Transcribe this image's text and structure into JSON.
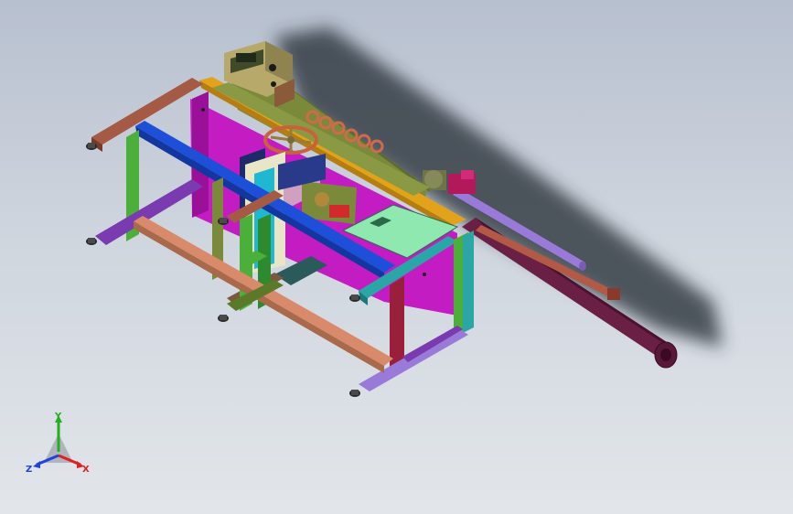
{
  "viewport": {
    "background_top": "#b7c0cf",
    "background_bottom": "#e2e6ea"
  },
  "model": {
    "description_icon": "cad-assembly-isometric",
    "colors": {
      "magenta_panel": "#c21cc2",
      "blue_beam": "#1d4fd8",
      "orange_beam": "#e2a21a",
      "green_leg": "#4caf3a",
      "olive_frame": "#7a8a3a",
      "brown_beam": "#a55a45",
      "salmon_beam": "#d98a6a",
      "purple_beam": "#7a3ab0",
      "maroon_leg": "#9a1f3a",
      "teal_beam": "#2aa6a6",
      "mint_plate": "#8fe8b0",
      "control_box": "#b7a96a",
      "long_roller": "#6a1f45",
      "lilac_shaft": "#9a7ad8",
      "copper_shaft": "#b25a46",
      "handwheel": "#c8623a"
    }
  },
  "triad": {
    "x_label": "X",
    "y_label": "Y",
    "z_label": "Z",
    "x_color": "#e02020",
    "y_color": "#20b020",
    "z_color": "#2040e0"
  }
}
